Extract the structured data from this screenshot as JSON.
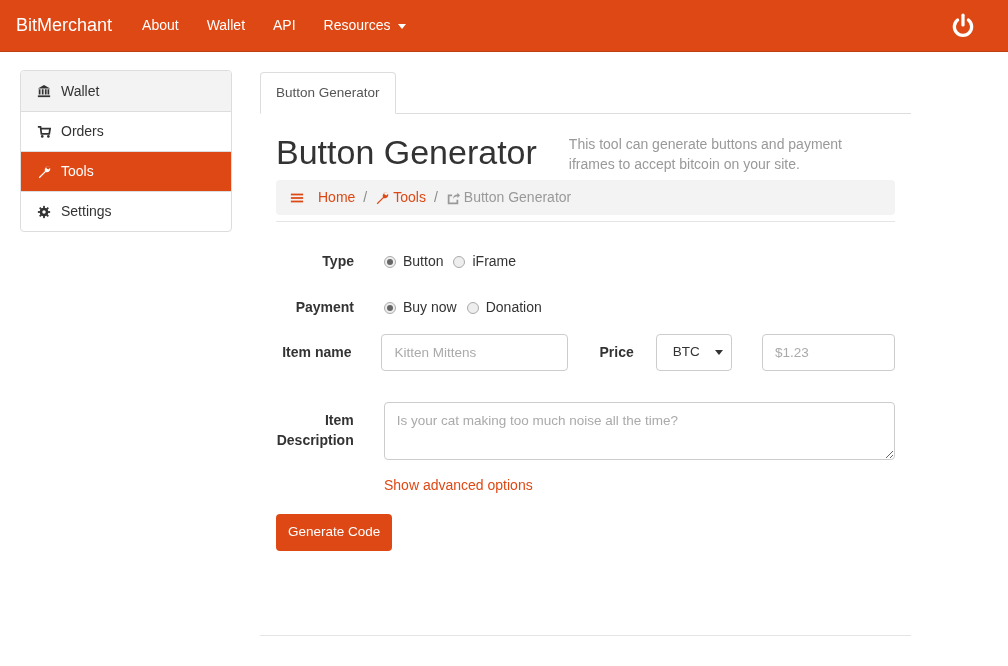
{
  "navbar": {
    "brand": "BitMerchant",
    "links": [
      {
        "label": "About",
        "dropdown": false
      },
      {
        "label": "Wallet",
        "dropdown": false
      },
      {
        "label": "API",
        "dropdown": false
      },
      {
        "label": "Resources",
        "dropdown": true
      }
    ]
  },
  "sidebar": {
    "items": [
      {
        "label": "Wallet",
        "kind": "bank",
        "selected": false,
        "highlighted": true
      },
      {
        "label": "Orders",
        "kind": "cart",
        "selected": false,
        "highlighted": false
      },
      {
        "label": "Tools",
        "kind": "wrench",
        "selected": true,
        "highlighted": false
      },
      {
        "label": "Settings",
        "kind": "gear",
        "selected": false,
        "highlighted": false
      }
    ]
  },
  "tabs": [
    {
      "label": "Button Generator",
      "selected": true
    }
  ],
  "header": {
    "title": "Button Generator",
    "description": "This tool can generate buttons and payment iframes to accept bitcoin on your site."
  },
  "breadcrumb": [
    {
      "label": "Home",
      "kind": "bars",
      "active": false
    },
    {
      "separator": "/",
      "label": "Tools",
      "kind": "wrench",
      "active": false
    },
    {
      "separator": "/",
      "label": "Button Generator",
      "kind": "share",
      "active": true
    }
  ],
  "form": {
    "type": {
      "label": "Type",
      "options": [
        {
          "label": "Button",
          "selected": true
        },
        {
          "label": "iFrame",
          "selected": false
        }
      ]
    },
    "payment": {
      "label": "Payment",
      "options": [
        {
          "label": "Buy now",
          "selected": true
        },
        {
          "label": "Donation",
          "selected": false
        }
      ]
    },
    "item_name": {
      "label": "Item name",
      "placeholder": "Kitten Mittens"
    },
    "price": {
      "label": "Price",
      "currency": "BTC",
      "placeholder": "$1.23"
    },
    "description": {
      "label_lines": [
        "Item",
        "Description"
      ],
      "placeholder": "Is your cat making too much noise all the time?"
    },
    "advanced_link": "Show advanced options",
    "submit": "Generate Code"
  }
}
